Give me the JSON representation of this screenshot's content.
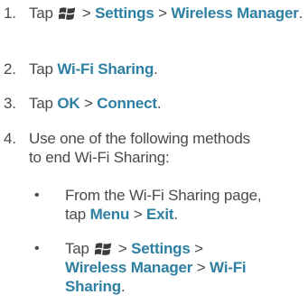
{
  "steps": [
    {
      "num": "1.",
      "tap": "Tap",
      "sep1": ">",
      "settings": "Settings",
      "sep2": ">",
      "wireless_manager": "Wireless Manager",
      "end": "."
    },
    {
      "num": "2.",
      "tap": "Tap",
      "wifi_sharing": "Wi-Fi Sharing",
      "end": "."
    },
    {
      "num": "3.",
      "tap": "Tap",
      "ok": "OK",
      "sep": ">",
      "connect": "Connect",
      "end": "."
    },
    {
      "num": "4.",
      "line1": "Use one of the following methods",
      "line2": "to end Wi-Fi Sharing:"
    }
  ],
  "methods": [
    {
      "bullet": "•",
      "line1": "From the Wi-Fi Sharing page,",
      "tap": "tap",
      "menu": "Menu",
      "sep": ">",
      "exit": "Exit",
      "end": "."
    },
    {
      "bullet": "•",
      "tap": "Tap",
      "sep1": ">",
      "settings": "Settings",
      "sep2": ">",
      "wireless_manager": "Wireless Manager",
      "sep3": ">",
      "wifi": "Wi-Fi",
      "sharing": "Sharing",
      "end": "."
    }
  ],
  "icon": "windows-start-icon",
  "colors": {
    "text": "#4a4a4a",
    "highlight": "#2d7fa3"
  }
}
